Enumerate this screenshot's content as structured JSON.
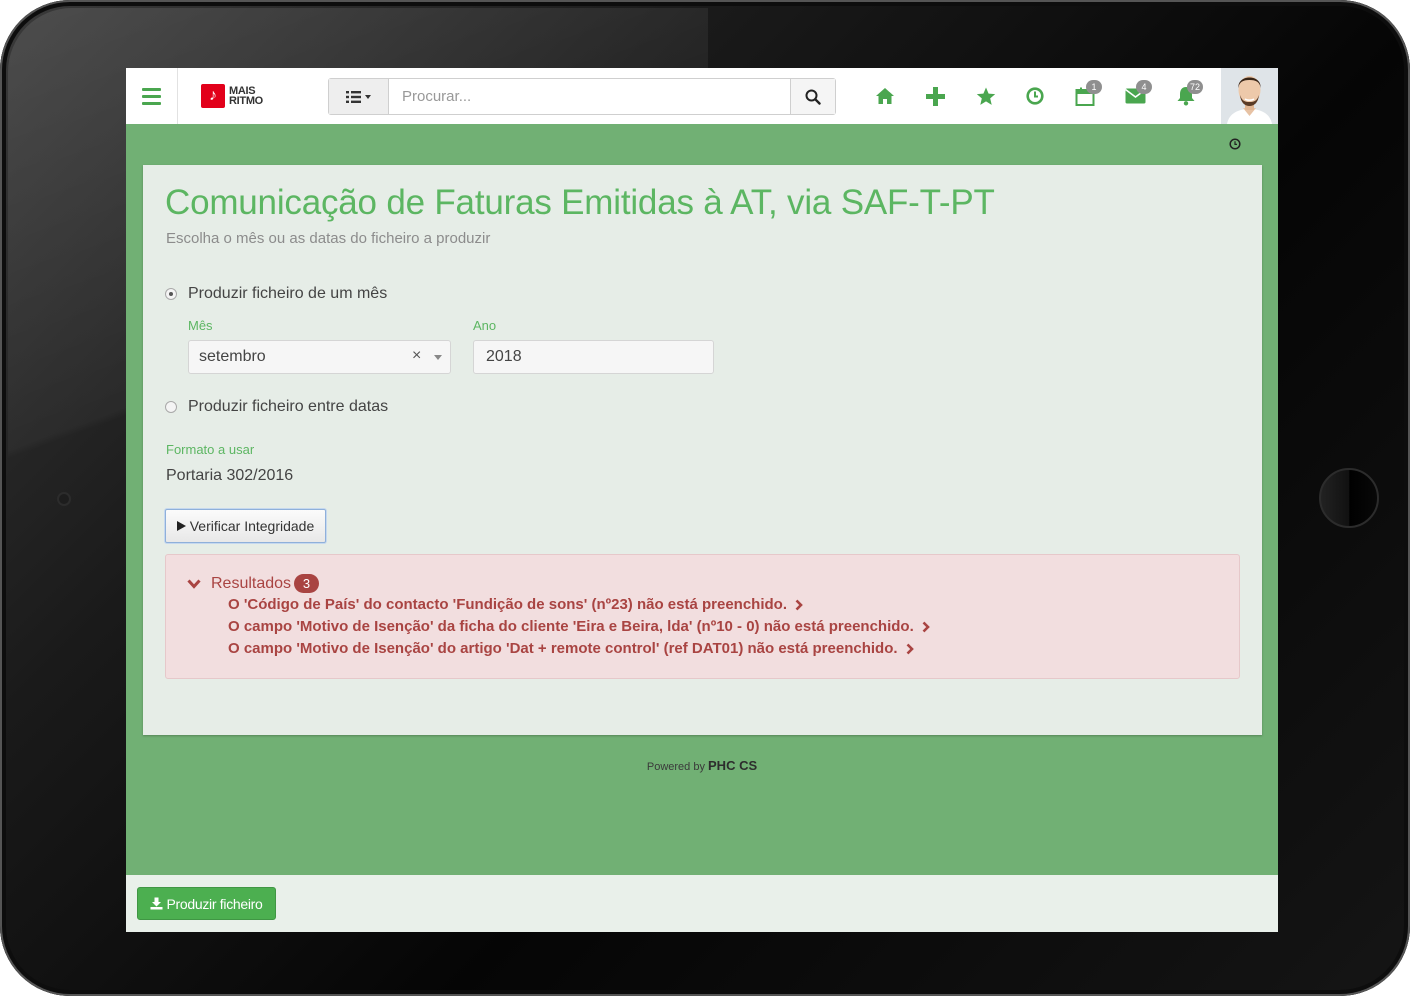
{
  "brand": {
    "line1": "MAIS",
    "line2": "RITMO",
    "color": "#e2001a"
  },
  "search": {
    "placeholder": "Procurar..."
  },
  "nav": {
    "accent": "#4aa64f",
    "items": [
      {
        "icon": "home-icon"
      },
      {
        "icon": "plus-icon"
      },
      {
        "icon": "star-icon"
      },
      {
        "icon": "clock-icon"
      },
      {
        "icon": "calendar-icon",
        "badge": "1"
      },
      {
        "icon": "envelope-icon",
        "badge": "4"
      },
      {
        "icon": "bell-icon",
        "badge": "72"
      }
    ]
  },
  "page": {
    "title": "Comunicação de Faturas Emitidas à AT, via SAF-T-PT",
    "subtitle": "Escolha o mês ou as datas do ficheiro a produzir"
  },
  "options": {
    "month_option": "Produzir ficheiro de um mês",
    "dates_option": "Produzir ficheiro entre datas",
    "selected": "month"
  },
  "fields": {
    "month_label": "Mês",
    "month_value": "setembro",
    "year_label": "Ano",
    "year_value": "2018",
    "format_label": "Formato a usar",
    "format_value": "Portaria 302/2016"
  },
  "actions": {
    "verify": "Verificar Integridade",
    "produce": "Produzir ficheiro"
  },
  "results": {
    "title": "Resultados",
    "count": "3",
    "items": [
      "O 'Código de País' do contacto 'Fundição de sons' (nº23) não está preenchido.",
      "O campo 'Motivo de Isenção' da ficha do cliente 'Eira e Beira, lda' (nº10 - 0) não está preenchido.",
      "O campo 'Motivo de Isenção' do artigo 'Dat + remote control' (ref DAT01) não está preenchido."
    ]
  },
  "footer": {
    "powered_by": "Powered by",
    "product": "PHC CS"
  },
  "colors": {
    "background": "#71b074",
    "card": "#e6ede7",
    "title": "#5cb662",
    "error": "#a94442",
    "error_bg": "#f2dedf",
    "button": "#4caf50"
  }
}
